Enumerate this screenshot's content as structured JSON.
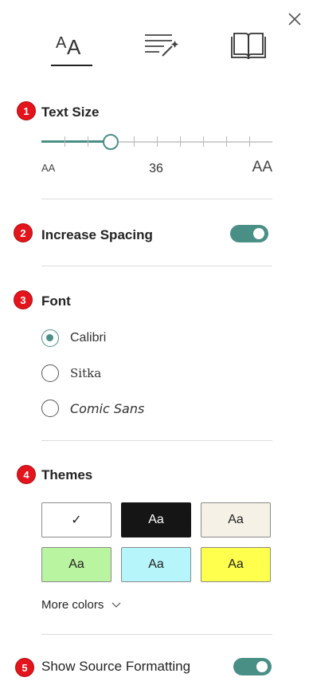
{
  "close_label": "Close",
  "tabs": [
    {
      "name": "text-preferences",
      "icon": "text-size-icon",
      "selected": true
    },
    {
      "name": "grammar-options",
      "icon": "magic-lines-icon",
      "selected": false
    },
    {
      "name": "reading-preferences",
      "icon": "book-icon",
      "selected": false
    }
  ],
  "text_size": {
    "badge": "1",
    "title": "Text Size",
    "value": "36",
    "small_label": "AA",
    "large_label": "AA",
    "level_fraction": 0.3,
    "ticks": 10
  },
  "spacing": {
    "badge": "2",
    "label": "Increase Spacing",
    "on": true
  },
  "font": {
    "badge": "3",
    "title": "Font",
    "options": [
      {
        "label": "Calibri",
        "checked": true
      },
      {
        "label": "Sitka",
        "checked": false
      },
      {
        "label": "Comic Sans",
        "checked": false
      }
    ]
  },
  "themes": {
    "badge": "4",
    "title": "Themes",
    "swatches": [
      {
        "label": "✓",
        "bg": "#ffffff",
        "fg": "#222222",
        "selected": true
      },
      {
        "label": "Aa",
        "bg": "#151515",
        "fg": "#ffffff",
        "selected": false
      },
      {
        "label": "Aa",
        "bg": "#f5f1e6",
        "fg": "#222222",
        "selected": false
      },
      {
        "label": "Aa",
        "bg": "#b9f5a0",
        "fg": "#222222",
        "selected": false
      },
      {
        "label": "Aa",
        "bg": "#b6f6fb",
        "fg": "#222222",
        "selected": false
      },
      {
        "label": "Aa",
        "bg": "#ffff4d",
        "fg": "#222222",
        "selected": false
      }
    ],
    "more_colors": "More colors"
  },
  "source_formatting": {
    "badge": "5",
    "label": "Show Source Formatting",
    "on": true
  },
  "colors": {
    "accent": "#4a8f85",
    "badge_red": "#e3141b"
  }
}
